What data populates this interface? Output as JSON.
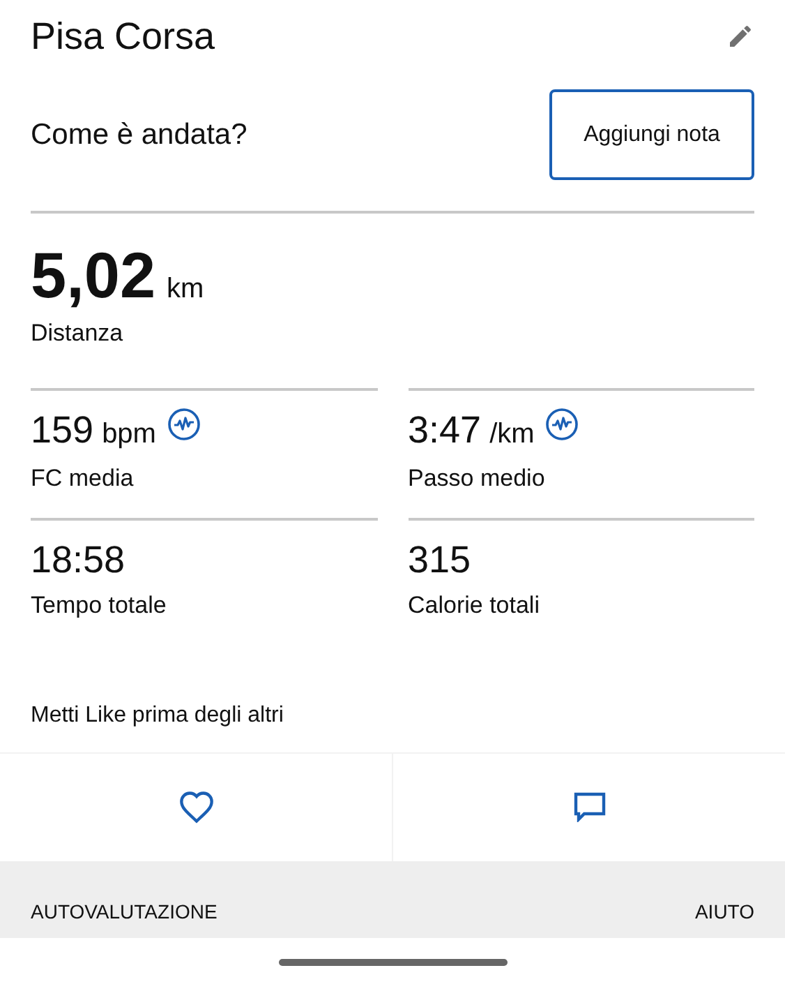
{
  "header": {
    "title": "Pisa Corsa"
  },
  "feedback": {
    "prompt": "Come è andata?",
    "button": "Aggiungi nota"
  },
  "distance": {
    "value": "5,02",
    "unit": "km",
    "label": "Distanza"
  },
  "stats": [
    {
      "value": "159",
      "unit": "bpm",
      "label": "FC media",
      "kind": "chart"
    },
    {
      "value": "3:47",
      "unit": "/km",
      "label": "Passo medio",
      "kind": "chart"
    },
    {
      "value": "18:58",
      "label": "Tempo totale",
      "kind": "plain"
    },
    {
      "value": "315",
      "label": "Calorie totali",
      "kind": "plain"
    }
  ],
  "like_prompt": "Metti Like prima degli altri",
  "footer": {
    "left": "AUTOVALUTAZIONE",
    "right": "AIUTO"
  }
}
